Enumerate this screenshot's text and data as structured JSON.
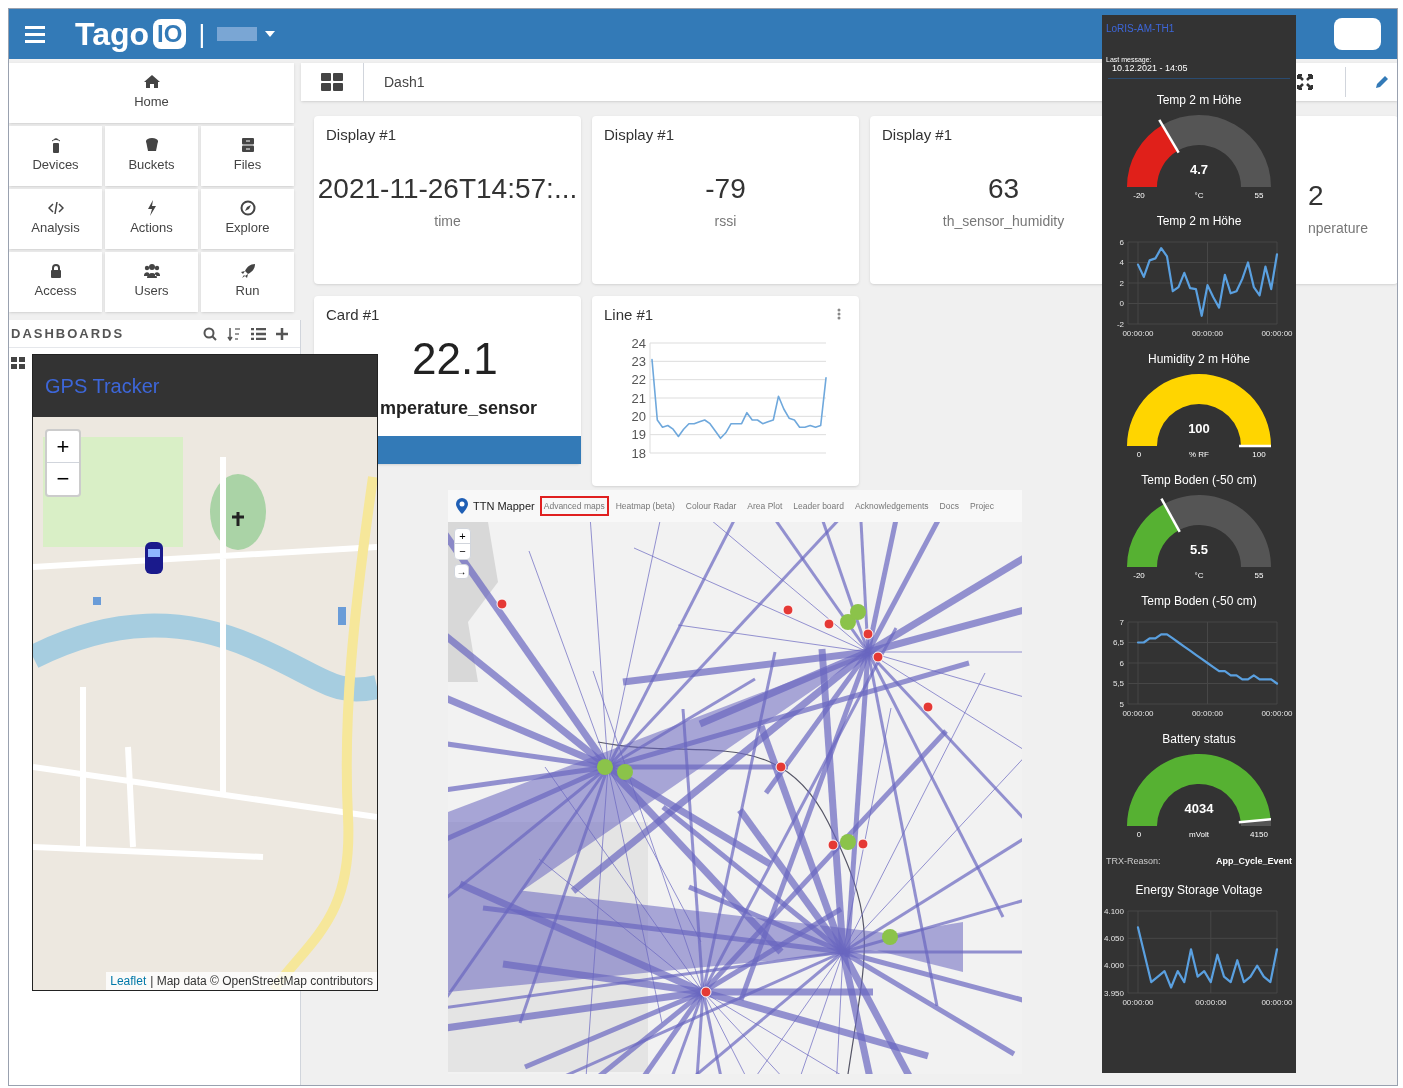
{
  "top_bar": {
    "logo_text": "Tago",
    "logo_badge": "IO",
    "separator": "|"
  },
  "sidebar": {
    "nav": [
      {
        "label": "Home"
      },
      {
        "label": "Devices"
      },
      {
        "label": "Buckets"
      },
      {
        "label": "Files"
      },
      {
        "label": "Analysis"
      },
      {
        "label": "Actions"
      },
      {
        "label": "Explore"
      },
      {
        "label": "Access"
      },
      {
        "label": "Users"
      },
      {
        "label": "Run"
      }
    ],
    "dashboards_heading": "DASHBOARDS"
  },
  "dashboard": {
    "title": "Dash1",
    "cards": [
      {
        "kind": "display",
        "title": "Display #1",
        "value": "2021-11-26T14:57:...",
        "label": "time"
      },
      {
        "kind": "display",
        "title": "Display #1",
        "value": "-79",
        "label": "rssi"
      },
      {
        "kind": "display",
        "title": "Display #1",
        "value": "63",
        "label": "th_sensor_humidity"
      },
      {
        "kind": "display",
        "value": "2",
        "label": "nperature"
      },
      {
        "kind": "card",
        "title": "Card #1",
        "value": "22.1",
        "label": "mperature_sensor"
      },
      {
        "kind": "line",
        "title": "Line #1",
        "chart_data": {
          "type": "line",
          "grid": true,
          "ylim": [
            18,
            24
          ],
          "yticks": [
            18,
            19,
            20,
            21,
            22,
            23,
            24
          ],
          "values": [
            23.1,
            19.8,
            19.4,
            19.5,
            19.3,
            18.9,
            19.3,
            19.6,
            19.6,
            19.7,
            19.8,
            19.6,
            19.2,
            18.8,
            19.1,
            19.6,
            19.6,
            19.6,
            20.2,
            19.8,
            19.8,
            19.6,
            19.7,
            19.8,
            21.1,
            20.4,
            19.9,
            19.8,
            19.4,
            19.4,
            19.5,
            19.4,
            19.5,
            22.1
          ]
        }
      }
    ]
  },
  "gps_tracker": {
    "title": "GPS Tracker",
    "zoom_in": "+",
    "zoom_out": "−",
    "attribution_link": "Leaflet",
    "attribution": "| Map data © OpenStreetMap contributors"
  },
  "ttn_mapper": {
    "brand": "TTN Mapper",
    "nav": [
      {
        "label": "Advanced maps",
        "selected": true
      },
      {
        "label": "Heatmap (beta)",
        "selected": false
      },
      {
        "label": "Colour Radar",
        "selected": false
      },
      {
        "label": "Area Plot",
        "selected": false
      },
      {
        "label": "Leader board",
        "selected": false
      },
      {
        "label": "Acknowledgements",
        "selected": false
      },
      {
        "label": "Docs",
        "selected": false
      },
      {
        "label": "Projec",
        "selected": false
      }
    ],
    "zoom_in": "+",
    "zoom_out": "−",
    "locate": "→"
  },
  "device_panel": {
    "title": "LoRIS-AM-TH1",
    "last_message_label": "Last message:",
    "last_message": "10.12.2021 - 14:05",
    "widgets": [
      {
        "kind": "gauge",
        "title": "Temp 2 m Höhe",
        "value": "4.7",
        "unit": "°C",
        "min": "-20",
        "max": "55",
        "level": 0.33,
        "color": "#e0201a"
      },
      {
        "kind": "chart",
        "title": "Temp 2 m Höhe",
        "chart_data": {
          "type": "line",
          "grid": true,
          "ylim": [
            -2,
            6
          ],
          "yticks": [
            -2,
            0,
            2,
            4,
            6
          ],
          "categories": [
            "00:00:00",
            null,
            null,
            null,
            null,
            null,
            null,
            null,
            null,
            null,
            null,
            null,
            "00:00:00",
            null,
            null,
            null,
            null,
            null,
            null,
            null,
            null,
            null,
            null,
            null,
            "00:00:00"
          ],
          "values": [
            3.8,
            2.6,
            4.2,
            4.4,
            5.4,
            4.6,
            1.2,
            1.6,
            3.0,
            1.5,
            1.4,
            -1.2,
            1.8,
            0.6,
            -0.4,
            2.8,
            1.0,
            1.2,
            2.4,
            4.0,
            1.6,
            0.8,
            3.6,
            1.4,
            4.8
          ]
        }
      },
      {
        "kind": "gauge",
        "title": "Humidity 2 m Höhe",
        "value": "100",
        "unit": "% RF",
        "min": "0",
        "max": "100",
        "level": 1,
        "color": "#ffd500"
      },
      {
        "kind": "gauge",
        "title": "Temp Boden (-50 cm)",
        "value": "5.5",
        "unit": "°C",
        "min": "-20",
        "max": "55",
        "level": 0.34,
        "color": "#56b132"
      },
      {
        "kind": "chart",
        "title": "Temp Boden (-50 cm)",
        "chart_data": {
          "type": "line",
          "grid": true,
          "ylim": [
            5,
            7
          ],
          "yticks": [
            {
              "value": 5,
              "label": "5"
            },
            {
              "value": 5.5,
              "label": "5,5"
            },
            {
              "value": 6,
              "label": "6"
            },
            {
              "value": 6.5,
              "label": "6,5"
            },
            {
              "value": 7,
              "label": "7"
            }
          ],
          "categories": [
            "00:00:00",
            null,
            null,
            null,
            null,
            null,
            null,
            null,
            null,
            null,
            null,
            null,
            "00:00:00",
            null,
            null,
            null,
            null,
            null,
            null,
            null,
            null,
            null,
            null,
            null,
            "00:00:00"
          ],
          "values": [
            6.5,
            6.5,
            6.6,
            6.6,
            6.7,
            6.7,
            6.6,
            6.5,
            6.4,
            6.3,
            6.2,
            6.1,
            6.0,
            5.9,
            5.8,
            5.8,
            5.7,
            5.7,
            5.6,
            5.6,
            5.7,
            5.6,
            5.6,
            5.6,
            5.5
          ]
        }
      },
      {
        "kind": "gauge",
        "title": "Battery status",
        "value": "4034",
        "unit": "mVolt",
        "min": "0",
        "max": "4150",
        "level": 0.97,
        "color": "#56b132"
      },
      {
        "kind": "field",
        "label": "TRX-Reason:",
        "value": "App_Cycle_Event"
      },
      {
        "kind": "chart",
        "title": "Energy Storage Voltage",
        "chart_data": {
          "type": "line",
          "grid": true,
          "ylim": [
            3.95,
            4.1
          ],
          "yticks": [
            {
              "value": 3.95,
              "label": "3.950"
            },
            {
              "value": 4.0,
              "label": "4.000"
            },
            {
              "value": 4.05,
              "label": "4.050"
            },
            {
              "value": 4.1,
              "label": "4.100"
            }
          ],
          "categories": [
            "00:00:00",
            null,
            null,
            null,
            null,
            null,
            null,
            null,
            null,
            null,
            null,
            "00:00:00",
            null,
            null,
            null,
            null,
            null,
            null,
            null,
            null,
            null,
            "00:00:00"
          ],
          "values": [
            4.07,
            4.02,
            3.97,
            3.98,
            3.99,
            3.96,
            3.99,
            3.97,
            4.03,
            3.98,
            3.99,
            3.97,
            4.02,
            3.98,
            3.97,
            4.01,
            3.97,
            3.98,
            4.0,
            3.98,
            3.97,
            4.03
          ]
        }
      }
    ]
  }
}
